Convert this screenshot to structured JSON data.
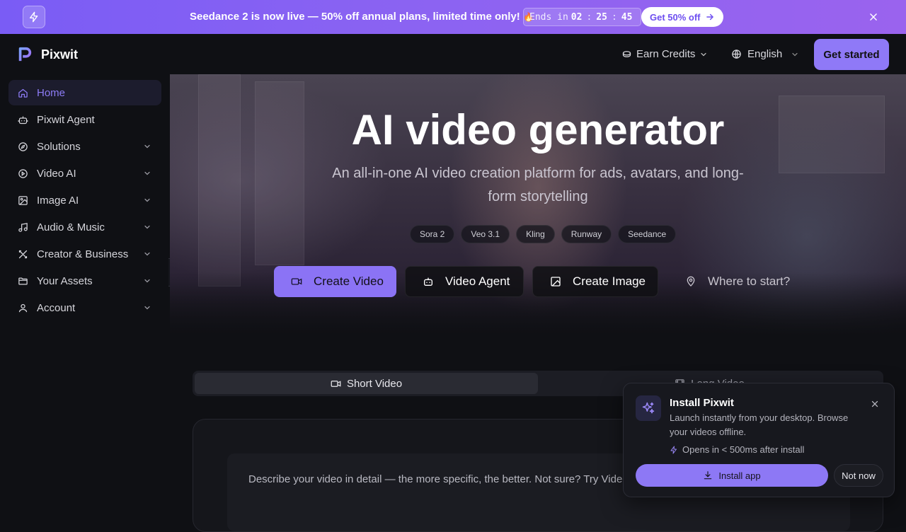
{
  "promo": {
    "message": "Seedance 2 is now live — 50% off annual plans, limited time only! ",
    "fire_emoji": "🔥",
    "timer_label": "Ends in",
    "timer_hours": "02",
    "timer_minutes": "25",
    "timer_seconds": "45",
    "timer_sep": ":",
    "cta": "Get 50% off"
  },
  "header": {
    "brand": "Pixwit",
    "earn_credits": "Earn Credits",
    "language": "English",
    "get_started": "Get started"
  },
  "sidebar": {
    "items": [
      {
        "label": "Home",
        "icon": "home-icon",
        "active": true
      },
      {
        "label": "Pixwit Agent",
        "icon": "robot-icon"
      },
      {
        "label": "Solutions",
        "icon": "compass-icon",
        "expandable": true
      },
      {
        "label": "Video AI",
        "icon": "play-circle-icon",
        "expandable": true
      },
      {
        "label": "Image AI",
        "icon": "image-icon",
        "expandable": true
      },
      {
        "label": "Audio & Music",
        "icon": "music-icon",
        "expandable": true
      },
      {
        "label": "Creator & Business",
        "icon": "tools-icon",
        "expandable": true
      },
      {
        "label": "Your Assets",
        "icon": "folder-icon",
        "expandable": true
      },
      {
        "label": "Account",
        "icon": "user-icon",
        "expandable": true
      }
    ]
  },
  "hero": {
    "title": "AI video generator",
    "subtitle": "An all-in-one AI video creation platform for ads, avatars, and long-form storytelling",
    "models": [
      "Sora 2",
      "Veo 3.1",
      "Kling",
      "Runway",
      "Seedance"
    ],
    "buttons": {
      "create_video": "Create Video",
      "video_agent": "Video Agent",
      "create_image": "Create Image",
      "where_to_start": "Where to start?"
    }
  },
  "tabs": {
    "short_video": "Short Video",
    "long_video": "Long Video"
  },
  "prompt": {
    "placeholder": "Describe your video in detail — the more specific, the better. Not sure? Try Video Agent."
  },
  "install_popup": {
    "title": "Install Pixwit",
    "description": "Launch instantly from your desktop. Browse your videos offline.",
    "note": "Opens in < 500ms after install",
    "install_button": "Install app",
    "not_now_button": "Not now"
  },
  "colors": {
    "accent": "#8b73f5",
    "promo_start": "#7a5cf5",
    "promo_end": "#9a63ee",
    "background": "#0f1014"
  }
}
